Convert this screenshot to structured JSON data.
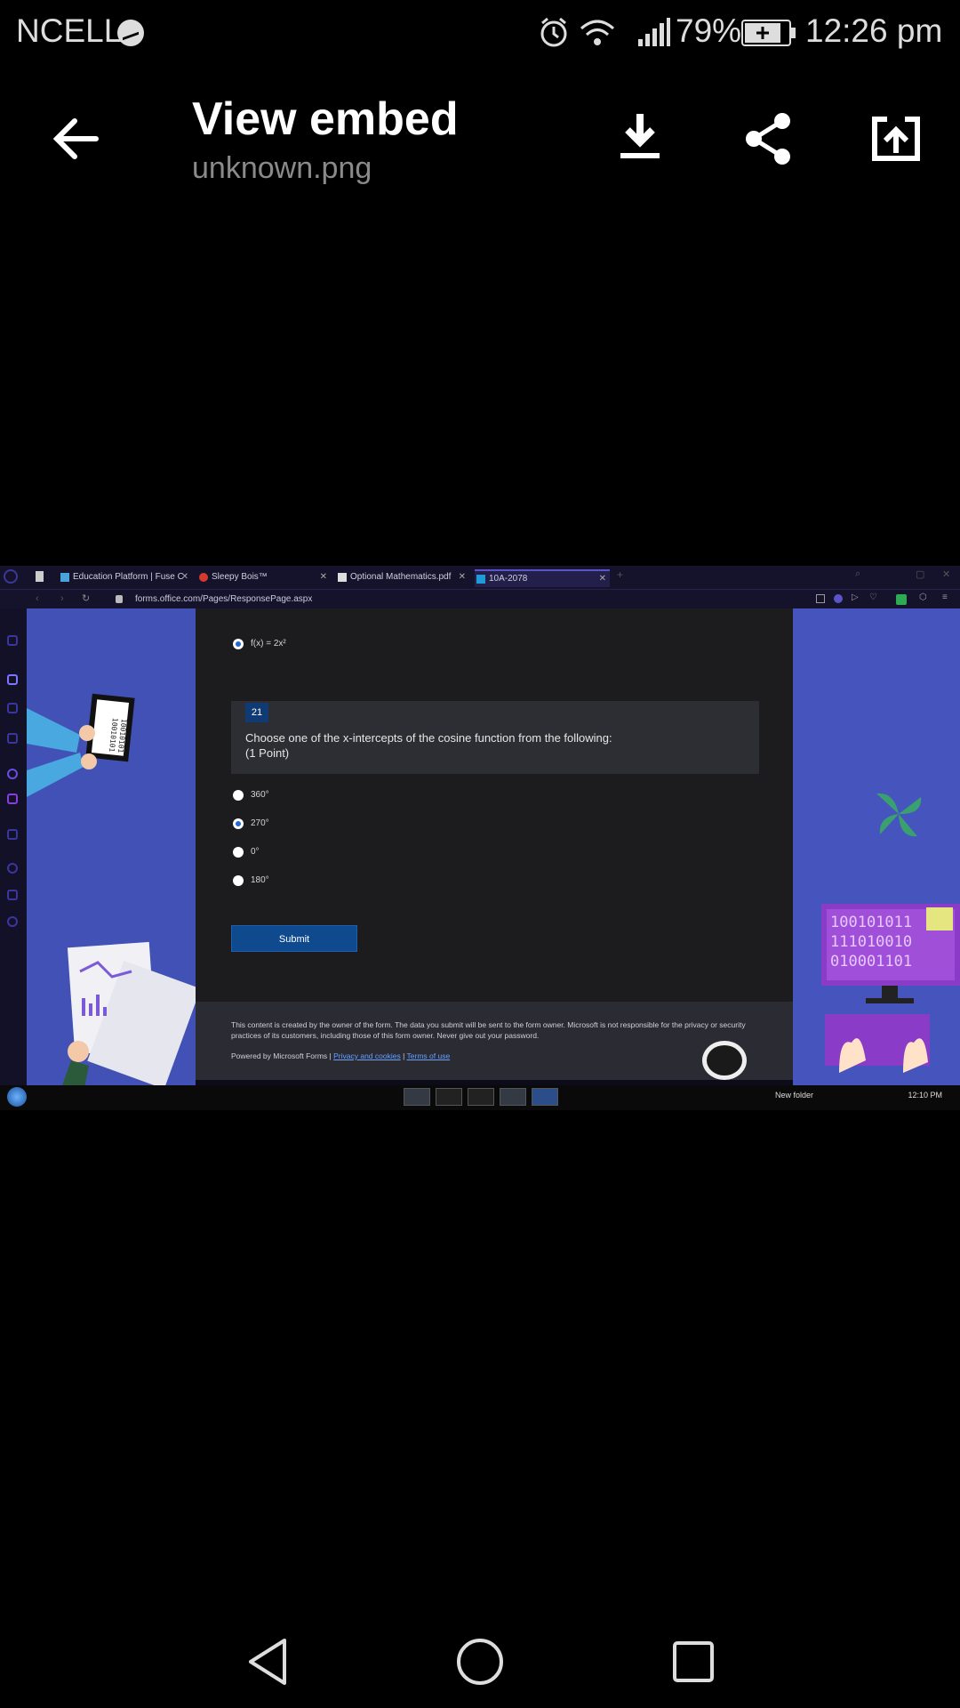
{
  "status_bar": {
    "carrier": "NCELL",
    "battery": "79%",
    "time": "12:26 pm"
  },
  "header": {
    "title": "View embed",
    "subtitle": "unknown.png"
  },
  "embedded": {
    "tabs": [
      {
        "label": "Education Platform | Fuse C"
      },
      {
        "label": "Sleepy Bois™"
      },
      {
        "label": "Optional Mathematics.pdf"
      },
      {
        "label": "10A-2078"
      }
    ],
    "url": "forms.office.com/Pages/ResponsePage.aspx",
    "prev_option": "f(x) = 2x²",
    "question_number": "21",
    "question_text": "Choose one of the x-intercepts of the cosine function from the following:",
    "question_points": "(1 Point)",
    "options": [
      {
        "label": "360°",
        "selected": false
      },
      {
        "label": "270°",
        "selected": true
      },
      {
        "label": "0°",
        "selected": false
      },
      {
        "label": "180°",
        "selected": false
      }
    ],
    "submit_label": "Submit",
    "footer_text": "This content is created by the owner of the form. The data you submit will be sent to the form owner. Microsoft is not responsible for the privacy or security practices of its customers, including those of this form owner. Never give out your password.",
    "powered_by": "Powered by Microsoft Forms |",
    "privacy_link": "Privacy and cookies",
    "sep": "|",
    "terms_link": "Terms of use",
    "binary_left": [
      "10010101",
      "10010101"
    ],
    "binary_right": [
      "100101011",
      "111010010",
      "010001101"
    ],
    "taskbar_folder": "New folder",
    "taskbar_time": "12:10 PM"
  }
}
